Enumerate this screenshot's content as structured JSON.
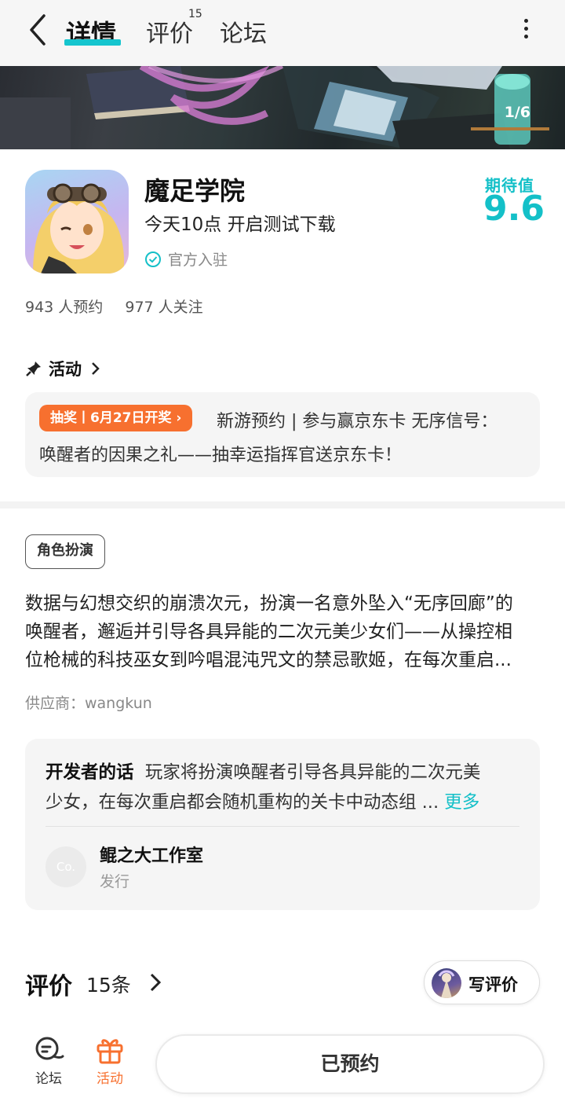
{
  "nav": {
    "tabs": [
      {
        "label": "详情",
        "active": true
      },
      {
        "label": "评价",
        "badge": "15"
      },
      {
        "label": "论坛"
      }
    ],
    "accent": "#15c5ce"
  },
  "banner": {
    "counter": "1/6"
  },
  "app": {
    "name": "魔足学院",
    "subtitle": "今天10点 开启测试下载",
    "official": "官方入驻",
    "score_label": "期待值",
    "score": "9.6",
    "reservations": "943 人预约",
    "followers": "977 人关注"
  },
  "activity": {
    "title": "活动",
    "badge": "抽奖丨6月27日开奖",
    "line1": "新游预约 | 参与赢京东卡 无序信号：",
    "line2": "唤醒者的因果之礼——抽幸运指挥官送京东卡！"
  },
  "intro": {
    "tag": "角色扮演",
    "lines": [
      "数据与幻想交织的崩溃次元，扮演一名意外坠入“无序回廊”的",
      "唤醒者，邂逅并引导各具异能的二次元美少女们——从操控相",
      "位枪械的科技巫女到吟唱混沌咒文的禁忌歌姬，在每次重启..."
    ],
    "supplier": "供应商：wangkun"
  },
  "developer": {
    "label": "开发者的话",
    "line1": "玩家将扮演唤醒者引导各具异能的二次元美",
    "line2": "少女，在每次重启都会随机重构的关卡中动态组 ...",
    "more": "更多",
    "avatar_text": "Co.",
    "studio": "鲲之大工作室",
    "role": "发行"
  },
  "reviews": {
    "title": "评价",
    "count": "15条",
    "write": "写评价"
  },
  "bottom": {
    "forum": "论坛",
    "activity": "活动",
    "reserved": "已预约",
    "activity_color": "#f7702f"
  }
}
